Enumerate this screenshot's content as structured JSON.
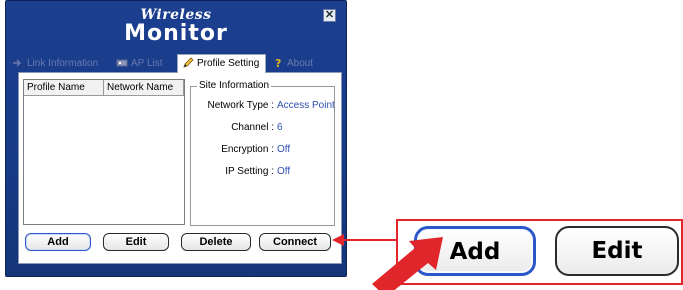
{
  "window": {
    "title_top": "Wireless",
    "title_main": "Monitor",
    "close_symbol": "✕"
  },
  "tabs": [
    {
      "label": "Link Information",
      "icon": "link-icon",
      "active": false
    },
    {
      "label": "AP List",
      "icon": "ap-list-icon",
      "active": false
    },
    {
      "label": "Profile Setting",
      "icon": "pencil-icon",
      "active": true
    },
    {
      "label": "About",
      "icon": "question-icon",
      "active": false
    }
  ],
  "profile_list": {
    "columns": [
      "Profile Name",
      "Network Name"
    ]
  },
  "site_information": {
    "title": "Site Information",
    "rows": [
      {
        "label": "Network Type :",
        "value": "Access Point"
      },
      {
        "label": "Channel :",
        "value": "6"
      },
      {
        "label": "Encryption :",
        "value": "Off"
      },
      {
        "label": "IP Setting :",
        "value": "Off"
      }
    ]
  },
  "buttons": {
    "add": "Add",
    "edit": "Edit",
    "delete": "Delete",
    "connect": "Connect"
  },
  "zoom": {
    "add": "Add",
    "edit": "Edit"
  },
  "colors": {
    "window_bg": "#1c3f8f",
    "accent_red": "#e0262a",
    "value_blue": "#2e4fb0",
    "focus_blue": "#2b57c9"
  }
}
